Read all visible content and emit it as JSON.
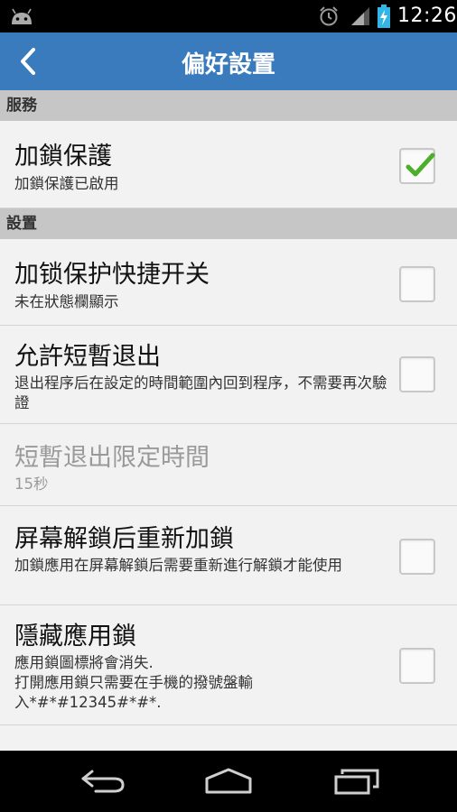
{
  "status_bar": {
    "time": "12:26",
    "icons": [
      "android-icon",
      "alarm-icon",
      "signal-icon",
      "battery-charging-icon"
    ]
  },
  "action_bar": {
    "title": "偏好設置",
    "back_icon": "back-chevron-icon"
  },
  "sections": [
    {
      "header": "服務",
      "items": [
        {
          "title": "加鎖保護",
          "summary": "加鎖保護已啟用",
          "checked": true,
          "enabled": true
        }
      ]
    },
    {
      "header": "設置",
      "items": [
        {
          "title": "加锁保护快捷开关",
          "summary": "未在狀態欄顯示",
          "checked": false,
          "enabled": true
        },
        {
          "title": "允許短暫退出",
          "summary": "退出程序后在設定的時間範圍內回到程序，不需要再次驗證",
          "checked": false,
          "enabled": true
        },
        {
          "title": "短暫退出限定時間",
          "summary": "15秒",
          "enabled": false
        },
        {
          "title": "屏幕解鎖后重新加鎖",
          "summary": "加鎖應用在屏幕解鎖后需要重新進行解鎖才能使用",
          "checked": false,
          "enabled": true
        },
        {
          "title": "隱藏應用鎖",
          "summary_lines": [
            "應用鎖圖標將會消失.",
            "打開應用鎖只需要在手機的撥號盤輸",
            "入*#*#12345#*#*."
          ],
          "checked": false,
          "enabled": true
        }
      ]
    }
  ],
  "nav_bar": {
    "icons": [
      "back-icon",
      "home-icon",
      "recent-apps-icon"
    ]
  },
  "colors": {
    "action_bar": "#3a7bbd",
    "section_header": "#c6c6c6",
    "background": "#f2f2f2",
    "check_green": "#4caf2a"
  }
}
